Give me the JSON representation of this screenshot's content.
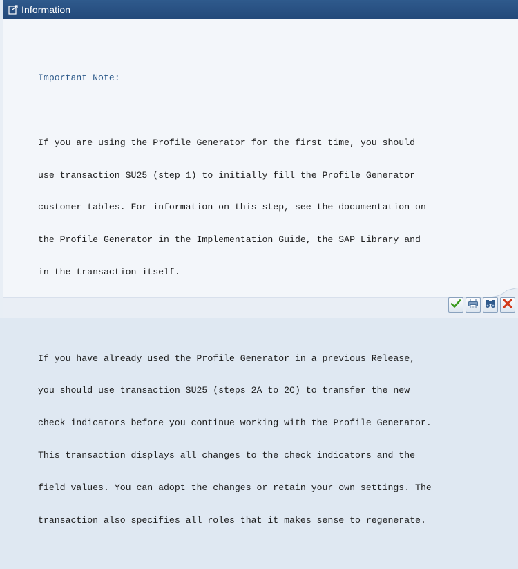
{
  "window": {
    "title": "Information",
    "title_icon": "external-window-icon"
  },
  "message": {
    "heading": "Important Note:",
    "paragraph1": [
      "If you are using the Profile Generator for the first time, you should",
      "use transaction SU25 (step 1) to initially fill the Profile Generator",
      "customer tables. For information on this step, see the documentation on",
      "the Profile Generator in the Implementation Guide, the SAP Library and",
      "in the transaction itself."
    ],
    "paragraph2": [
      "If you have already used the Profile Generator in a previous Release,",
      "you should use transaction SU25 (steps 2A to 2C) to transfer the new",
      "check indicators before you continue working with the Profile Generator.",
      "This transaction displays all changes to the check indicators and the",
      "field values. You can adopt the changes or retain your own settings. The",
      "transaction also specifies all roles that it makes sense to regenerate."
    ]
  },
  "toolbar": {
    "buttons": [
      {
        "name": "continue-button",
        "icon": "checkmark-icon",
        "color": "#3a9a1e"
      },
      {
        "name": "print-button",
        "icon": "printer-icon",
        "color": "#4a6f99"
      },
      {
        "name": "find-button",
        "icon": "binoculars-icon",
        "color": "#2f5a8c"
      },
      {
        "name": "cancel-button",
        "icon": "close-icon",
        "color": "#d23a1a"
      }
    ]
  },
  "colors": {
    "titlebar": "#2f5a8c",
    "heading_text": "#2d5a8a",
    "body_text": "#1e1e1e",
    "background": "#f3f6fa"
  }
}
